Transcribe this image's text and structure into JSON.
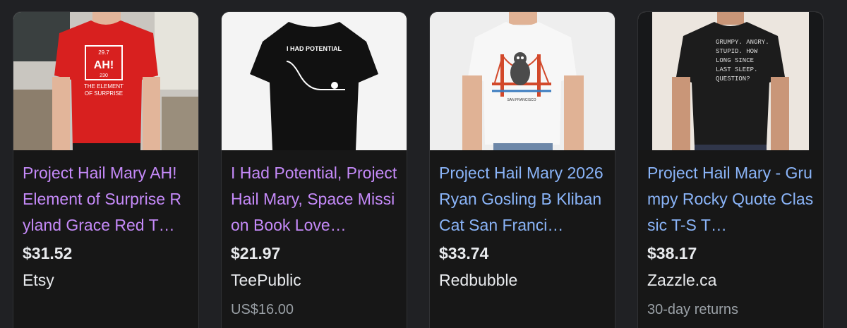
{
  "colors": {
    "background": "#202124",
    "card_background": "#171717",
    "visited_link": "#c58af9",
    "link": "#8ab4f8",
    "primary_text": "#e8eaed",
    "secondary_text": "#9aa0a6"
  },
  "products": [
    {
      "title": "Project Hail Mary AH! Element of Surprise Ryland Grace Red T…",
      "price": "$31.52",
      "merchant": "Etsy",
      "extra": "",
      "image": {
        "description": "man wearing red t-shirt in classroom",
        "shirt_color": "#d8201f",
        "shirt_text_top": "29.7",
        "shirt_symbol": "AH!",
        "shirt_text_num": "230",
        "shirt_text_line1": "THE ELEMENT",
        "shirt_text_line2": "OF SURPRISE"
      }
    },
    {
      "title": "I Had Potential, Project Hail Mary, Space Mission Book Love…",
      "price": "$21.97",
      "merchant": "TeePublic",
      "extra": "US$16.00",
      "image": {
        "description": "black t-shirt with potential energy graph",
        "shirt_color": "#111111",
        "shirt_text": "I HAD POTENTIAL"
      }
    },
    {
      "title": "Project Hail Mary 2026 Ryan Gosling B Kliban Cat San Franci…",
      "price": "$33.74",
      "merchant": "Redbubble",
      "extra": "",
      "image": {
        "description": "man wearing white t-shirt with cat on golden gate bridge",
        "shirt_color": "#f2f2f2",
        "shirt_text": "SAN FRANCISCO"
      }
    },
    {
      "title": "Project Hail Mary - Grumpy Rocky Quote Classic T-S T…",
      "price": "$38.17",
      "merchant": "Zazzle.ca",
      "extra": "30-day returns",
      "image": {
        "description": "man wearing black t-shirt with grumpy quote",
        "shirt_color": "#1c1c1c",
        "shirt_lines": [
          "GRUMPY. ANGRY.",
          "STUPID. HOW",
          "LONG SINCE",
          "LAST SLEEP.",
          "QUESTION?"
        ]
      }
    }
  ]
}
